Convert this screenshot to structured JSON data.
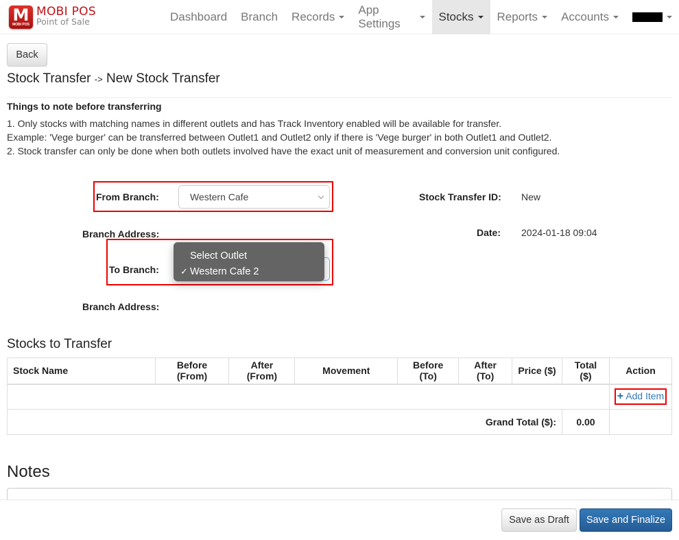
{
  "brand": {
    "logo_letter": "M",
    "logo_subtext": "MOBI POS",
    "title": "MOBI POS",
    "subtitle": "Point of Sale"
  },
  "nav": {
    "items": [
      {
        "label": "Dashboard",
        "dropdown": false,
        "active": false
      },
      {
        "label": "Branch",
        "dropdown": false,
        "active": false
      },
      {
        "label": "Records",
        "dropdown": true,
        "active": false
      },
      {
        "label": "App Settings",
        "dropdown": true,
        "active": false
      },
      {
        "label": "Stocks",
        "dropdown": true,
        "active": true
      },
      {
        "label": "Reports",
        "dropdown": true,
        "active": false
      },
      {
        "label": "Accounts",
        "dropdown": true,
        "active": false
      }
    ],
    "user_menu": {
      "label": "[redacted]",
      "dropdown": true
    }
  },
  "page": {
    "back_label": "Back",
    "breadcrumb_parent": "Stock Transfer",
    "breadcrumb_separator": "->",
    "breadcrumb_current": "New Stock Transfer"
  },
  "notes_info": {
    "heading": "Things to note before transferring",
    "lines": [
      "1. Only stocks with matching names in different outlets and has Track Inventory enabled will be available for transfer.",
      "Example: 'Vege burger' can be transferred between Outlet1 and Outlet2 only if there is 'Vege burger' in both Outlet1 and Outlet2.",
      "2. Stock transfer can only be done when both outlets involved have the exact unit of measurement and conversion unit configured."
    ]
  },
  "form": {
    "from_branch_label": "From Branch:",
    "from_branch_value": "Western Cafe",
    "from_address_label": "Branch Address:",
    "to_branch_label": "To Branch:",
    "to_branch_options": [
      {
        "label": "Select Outlet",
        "selected": false
      },
      {
        "label": "Western Cafe 2",
        "selected": true
      }
    ],
    "to_address_label": "Branch Address:",
    "transfer_id_label": "Stock Transfer ID:",
    "transfer_id_value": "New",
    "date_label": "Date:",
    "date_value": "2024-01-18 09:04",
    "check_mark": "✓"
  },
  "stocks": {
    "title": "Stocks to Transfer",
    "columns": [
      "Stock Name",
      "Before (From)",
      "After (From)",
      "Movement",
      "Before (To)",
      "After (To)",
      "Price ($)",
      "Total ($)",
      "Action"
    ],
    "add_item_label": "Add Item",
    "add_item_icon": "plus-icon",
    "grand_total_label": "Grand Total ($):",
    "grand_total_value": "0.00"
  },
  "notes": {
    "title": "Notes",
    "value": ""
  },
  "footer": {
    "save_draft_label": "Save as Draft",
    "save_finalize_label": "Save and Finalize"
  },
  "colors": {
    "brand_red": "#c0141a",
    "highlight_box": "#ee0000",
    "primary_button": "#2d6da8",
    "link": "#337ab7"
  }
}
